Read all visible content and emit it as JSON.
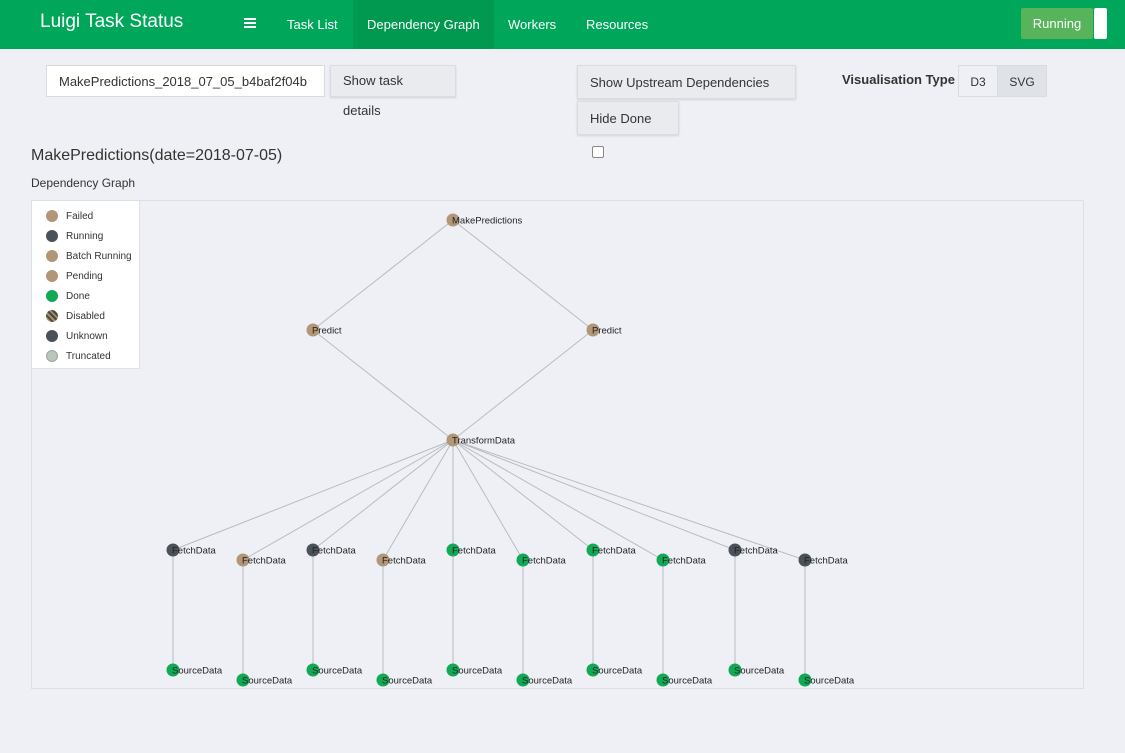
{
  "app_title": "Luigi Task Status",
  "nav": {
    "items": [
      {
        "label": "Task List",
        "active": false
      },
      {
        "label": "Dependency Graph",
        "active": true
      },
      {
        "label": "Workers",
        "active": false
      },
      {
        "label": "Resources",
        "active": false
      }
    ],
    "menu_icon": "hamburger-icon",
    "status_label": "Running"
  },
  "toolbar": {
    "task_id_value": "MakePredictions_2018_07_05_b4baf2f04b",
    "show_details_label": "Show task details",
    "show_upstream_label": "Show Upstream Dependencies",
    "hide_done_label": "Hide Done",
    "vis_type_label": "Visualisation Type",
    "vis_options": [
      "D3",
      "SVG"
    ],
    "vis_selected": "SVG"
  },
  "page": {
    "title": "MakePredictions(date=2018-07-05)",
    "subtitle": "Dependency Graph"
  },
  "legend": [
    {
      "label": "Failed",
      "color": "#b19677"
    },
    {
      "label": "Running",
      "color": "#4a5159"
    },
    {
      "label": "Batch Running",
      "color": "#b19677"
    },
    {
      "label": "Pending",
      "color": "#b19677"
    },
    {
      "label": "Done",
      "color": "#10a956"
    },
    {
      "label": "Disabled",
      "color": "#6b6b5a"
    },
    {
      "label": "Unknown",
      "color": "#4a5159"
    },
    {
      "label": "Truncated",
      "color": "#b9c5bd"
    }
  ],
  "status_colors": {
    "pending": "#b19677",
    "running": "#4a5159",
    "done": "#10a956"
  },
  "graph": {
    "nodes": [
      {
        "id": "mp",
        "label": "MakePredictions",
        "status": "pending"
      },
      {
        "id": "p1",
        "label": "Predict",
        "status": "pending"
      },
      {
        "id": "p2",
        "label": "Predict",
        "status": "pending"
      },
      {
        "id": "td",
        "label": "TransformData",
        "status": "pending"
      },
      {
        "id": "f1",
        "label": "FetchData",
        "status": "running"
      },
      {
        "id": "f2",
        "label": "FetchData",
        "status": "pending"
      },
      {
        "id": "f3",
        "label": "FetchData",
        "status": "running"
      },
      {
        "id": "f4",
        "label": "FetchData",
        "status": "pending"
      },
      {
        "id": "f5",
        "label": "FetchData",
        "status": "done"
      },
      {
        "id": "f6",
        "label": "FetchData",
        "status": "done"
      },
      {
        "id": "f7",
        "label": "FetchData",
        "status": "done"
      },
      {
        "id": "f8",
        "label": "FetchData",
        "status": "done"
      },
      {
        "id": "f9",
        "label": "FetchData",
        "status": "running"
      },
      {
        "id": "f10",
        "label": "FetchData",
        "status": "running"
      },
      {
        "id": "s1",
        "label": "SourceData",
        "status": "done"
      },
      {
        "id": "s2",
        "label": "SourceData",
        "status": "done"
      },
      {
        "id": "s3",
        "label": "SourceData",
        "status": "done"
      },
      {
        "id": "s4",
        "label": "SourceData",
        "status": "done"
      },
      {
        "id": "s5",
        "label": "SourceData",
        "status": "done"
      },
      {
        "id": "s6",
        "label": "SourceData",
        "status": "done"
      },
      {
        "id": "s7",
        "label": "SourceData",
        "status": "done"
      },
      {
        "id": "s8",
        "label": "SourceData",
        "status": "done"
      },
      {
        "id": "s9",
        "label": "SourceData",
        "status": "done"
      },
      {
        "id": "s10",
        "label": "SourceData",
        "status": "done"
      }
    ],
    "edges": [
      [
        "mp",
        "p1"
      ],
      [
        "mp",
        "p2"
      ],
      [
        "p1",
        "td"
      ],
      [
        "p2",
        "td"
      ],
      [
        "td",
        "f1"
      ],
      [
        "td",
        "f2"
      ],
      [
        "td",
        "f3"
      ],
      [
        "td",
        "f4"
      ],
      [
        "td",
        "f5"
      ],
      [
        "td",
        "f6"
      ],
      [
        "td",
        "f7"
      ],
      [
        "td",
        "f8"
      ],
      [
        "td",
        "f9"
      ],
      [
        "td",
        "f10"
      ],
      [
        "f1",
        "s1"
      ],
      [
        "f2",
        "s2"
      ],
      [
        "f3",
        "s3"
      ],
      [
        "f4",
        "s4"
      ],
      [
        "f5",
        "s5"
      ],
      [
        "f6",
        "s6"
      ],
      [
        "f7",
        "s7"
      ],
      [
        "f8",
        "s8"
      ],
      [
        "f9",
        "s9"
      ],
      [
        "f10",
        "s10"
      ]
    ]
  }
}
